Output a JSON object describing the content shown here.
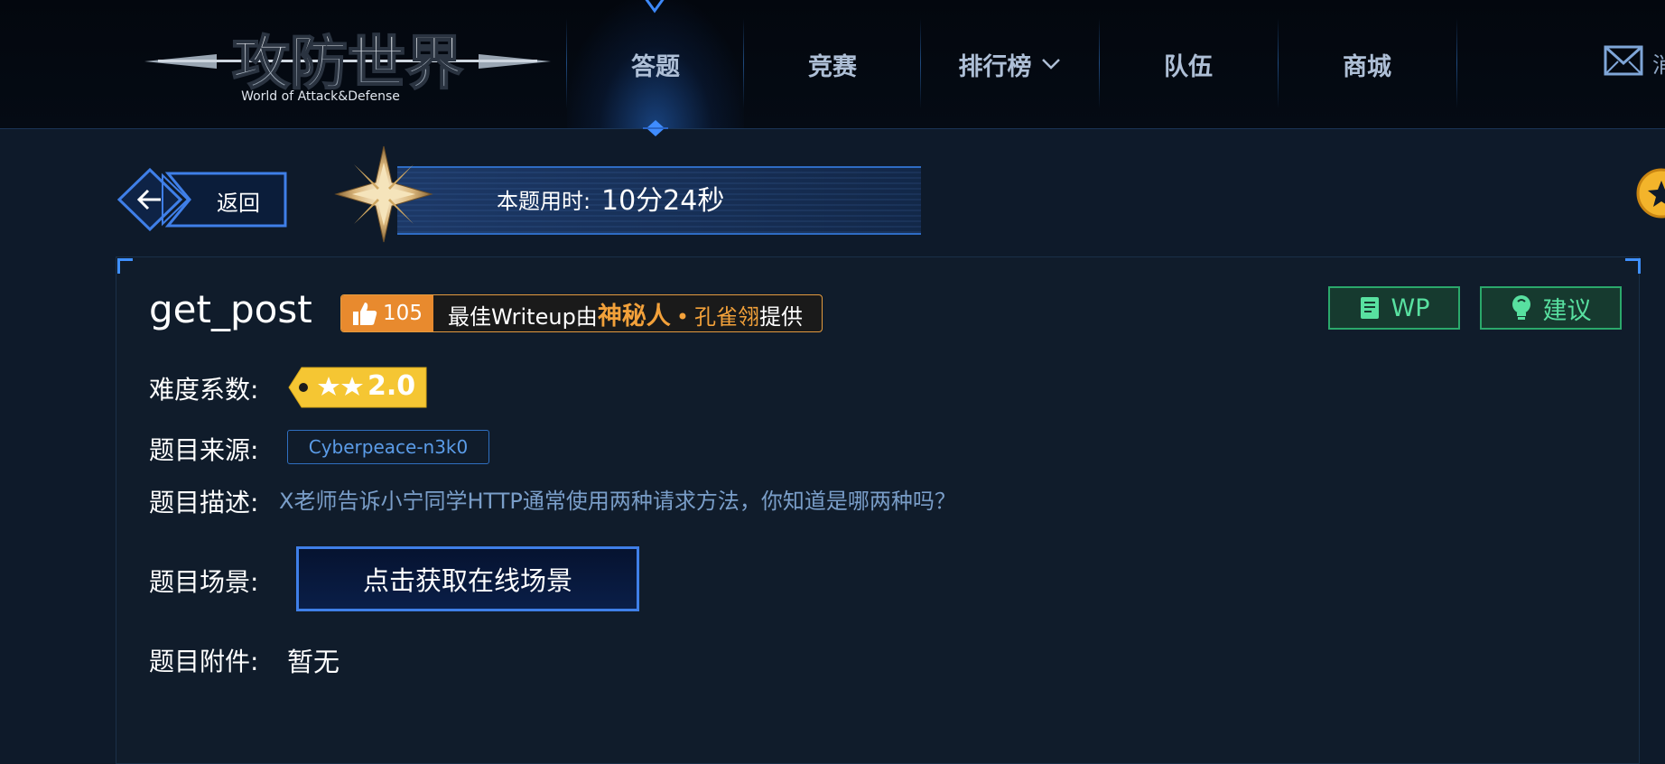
{
  "header": {
    "logo_text": "攻防世界",
    "logo_subtitle": "World of Attack&Defense",
    "nav": [
      {
        "label": "答题",
        "active": true
      },
      {
        "label": "竞赛",
        "active": false
      },
      {
        "label": "排行榜",
        "active": false,
        "has_dropdown": true
      },
      {
        "label": "队伍",
        "active": false
      },
      {
        "label": "商城",
        "active": false
      }
    ],
    "mail_label": "消",
    "icons": {
      "mail": "mail-icon",
      "dropdown": "chevron-down-icon"
    }
  },
  "toolbar": {
    "back_label": "返回",
    "timer_label": "本题用时:",
    "timer_value": "10分24秒"
  },
  "challenge": {
    "title": "get_post",
    "likes": "105",
    "writeup_prefix": "最佳Writeup由",
    "writeup_author": "神秘人",
    "writeup_dot": "•",
    "writeup_sub": "孔雀翎",
    "writeup_suffix": "提供",
    "wp_label": "WP",
    "suggest_label": "建议",
    "difficulty_label": "难度系数:",
    "difficulty_value": "2.0",
    "difficulty_stars": 2,
    "source_label": "题目来源:",
    "source_value": "Cyberpeace-n3k0",
    "desc_label": "题目描述:",
    "desc_value": "X老师告诉小宁同学HTTP通常使用两种请求方法，你知道是哪两种吗？",
    "scene_label": "题目场景:",
    "scene_button": "点击获取在线场景",
    "attach_label": "题目附件:",
    "attach_value": "暂无"
  },
  "colors": {
    "accent_blue": "#3f7fe8",
    "writeup_orange": "#e88a2e",
    "green_button": "#2ba86b",
    "difficulty_yellow": "#f5c633"
  }
}
